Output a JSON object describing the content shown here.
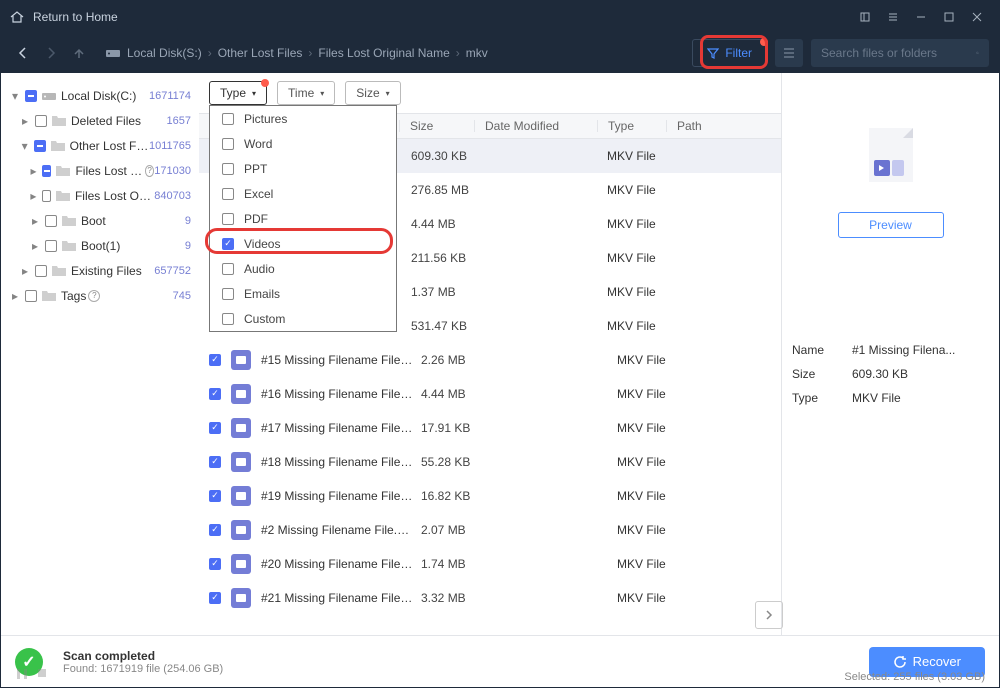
{
  "titlebar": {
    "home_label": "Return to Home"
  },
  "toolbar": {
    "breadcrumbs": [
      "Local Disk(S:)",
      "Other Lost Files",
      "Files Lost Original Name",
      "mkv"
    ],
    "filter_label": "Filter",
    "search_placeholder": "Search files or folders"
  },
  "sidebar": {
    "items": [
      {
        "label": "Local Disk(C:)",
        "count": "1671174",
        "depth": 0,
        "cb": "minus",
        "chev": "▾",
        "icon": "disk"
      },
      {
        "label": "Deleted Files",
        "count": "1657",
        "depth": 1,
        "cb": "none",
        "chev": "▸",
        "icon": "folder"
      },
      {
        "label": "Other Lost Files",
        "count": "1011765",
        "depth": 1,
        "cb": "minus",
        "chev": "▾",
        "icon": "folder"
      },
      {
        "label": "Files Lost Origi...",
        "count": "171030",
        "depth": 2,
        "cb": "minus",
        "chev": "▸",
        "icon": "folder",
        "help": true
      },
      {
        "label": "Files Lost Original ...",
        "count": "840703",
        "depth": 2,
        "cb": "none",
        "chev": "▸",
        "icon": "folder"
      },
      {
        "label": "Boot",
        "count": "9",
        "depth": 2,
        "cb": "none",
        "chev": "▸",
        "icon": "folder"
      },
      {
        "label": "Boot(1)",
        "count": "9",
        "depth": 2,
        "cb": "none",
        "chev": "▸",
        "icon": "folder"
      },
      {
        "label": "Existing Files",
        "count": "657752",
        "depth": 1,
        "cb": "none",
        "chev": "▸",
        "icon": "folder"
      },
      {
        "label": "Tags",
        "count": "745",
        "depth": 0,
        "cb": "none",
        "chev": "▸",
        "icon": "folder",
        "help": true
      }
    ]
  },
  "filter_tabs": {
    "type": "Type",
    "time": "Time",
    "size": "Size",
    "type_options": [
      {
        "label": "Pictures",
        "checked": false
      },
      {
        "label": "Word",
        "checked": false
      },
      {
        "label": "PPT",
        "checked": false
      },
      {
        "label": "Excel",
        "checked": false
      },
      {
        "label": "PDF",
        "checked": false
      },
      {
        "label": "Videos",
        "checked": true
      },
      {
        "label": "Audio",
        "checked": false
      },
      {
        "label": "Emails",
        "checked": false
      },
      {
        "label": "Custom",
        "checked": false
      }
    ]
  },
  "columns": {
    "name": "Name",
    "size": "Size",
    "date": "Date Modified",
    "type": "Type",
    "path": "Path"
  },
  "files": [
    {
      "name": "",
      "size": "609.30 KB",
      "type": "MKV File",
      "selected": true
    },
    {
      "name": "",
      "size": "276.85 MB",
      "type": "MKV File"
    },
    {
      "name": "",
      "size": "4.44 MB",
      "type": "MKV File"
    },
    {
      "name": "",
      "size": "211.56 KB",
      "type": "MKV File"
    },
    {
      "name": "",
      "size": "1.37 MB",
      "type": "MKV File"
    },
    {
      "name": "",
      "size": "531.47 KB",
      "type": "MKV File"
    },
    {
      "name": "#15 Missing Filename File.mkv",
      "size": "2.26 MB",
      "type": "MKV File"
    },
    {
      "name": "#16 Missing Filename File.mkv",
      "size": "4.44 MB",
      "type": "MKV File"
    },
    {
      "name": "#17 Missing Filename File.mkv",
      "size": "17.91 KB",
      "type": "MKV File"
    },
    {
      "name": "#18 Missing Filename File.mkv",
      "size": "55.28 KB",
      "type": "MKV File"
    },
    {
      "name": "#19 Missing Filename File.mkv",
      "size": "16.82 KB",
      "type": "MKV File"
    },
    {
      "name": "#2 Missing Filename File.mkv",
      "size": "2.07 MB",
      "type": "MKV File"
    },
    {
      "name": "#20 Missing Filename File.mkv",
      "size": "1.74 MB",
      "type": "MKV File"
    },
    {
      "name": "#21 Missing Filename File.mkv",
      "size": "3.32 MB",
      "type": "MKV File"
    }
  ],
  "preview": {
    "button": "Preview",
    "meta": {
      "name_k": "Name",
      "name_v": "#1 Missing Filena...",
      "size_k": "Size",
      "size_v": "609.30 KB",
      "type_k": "Type",
      "type_v": "MKV File"
    }
  },
  "status": {
    "title": "Scan completed",
    "subtitle": "Found: 1671919 file (254.06 GB)",
    "recover_label": "Recover",
    "selected_info": "Selected: 255 files (3.03 GB)"
  }
}
